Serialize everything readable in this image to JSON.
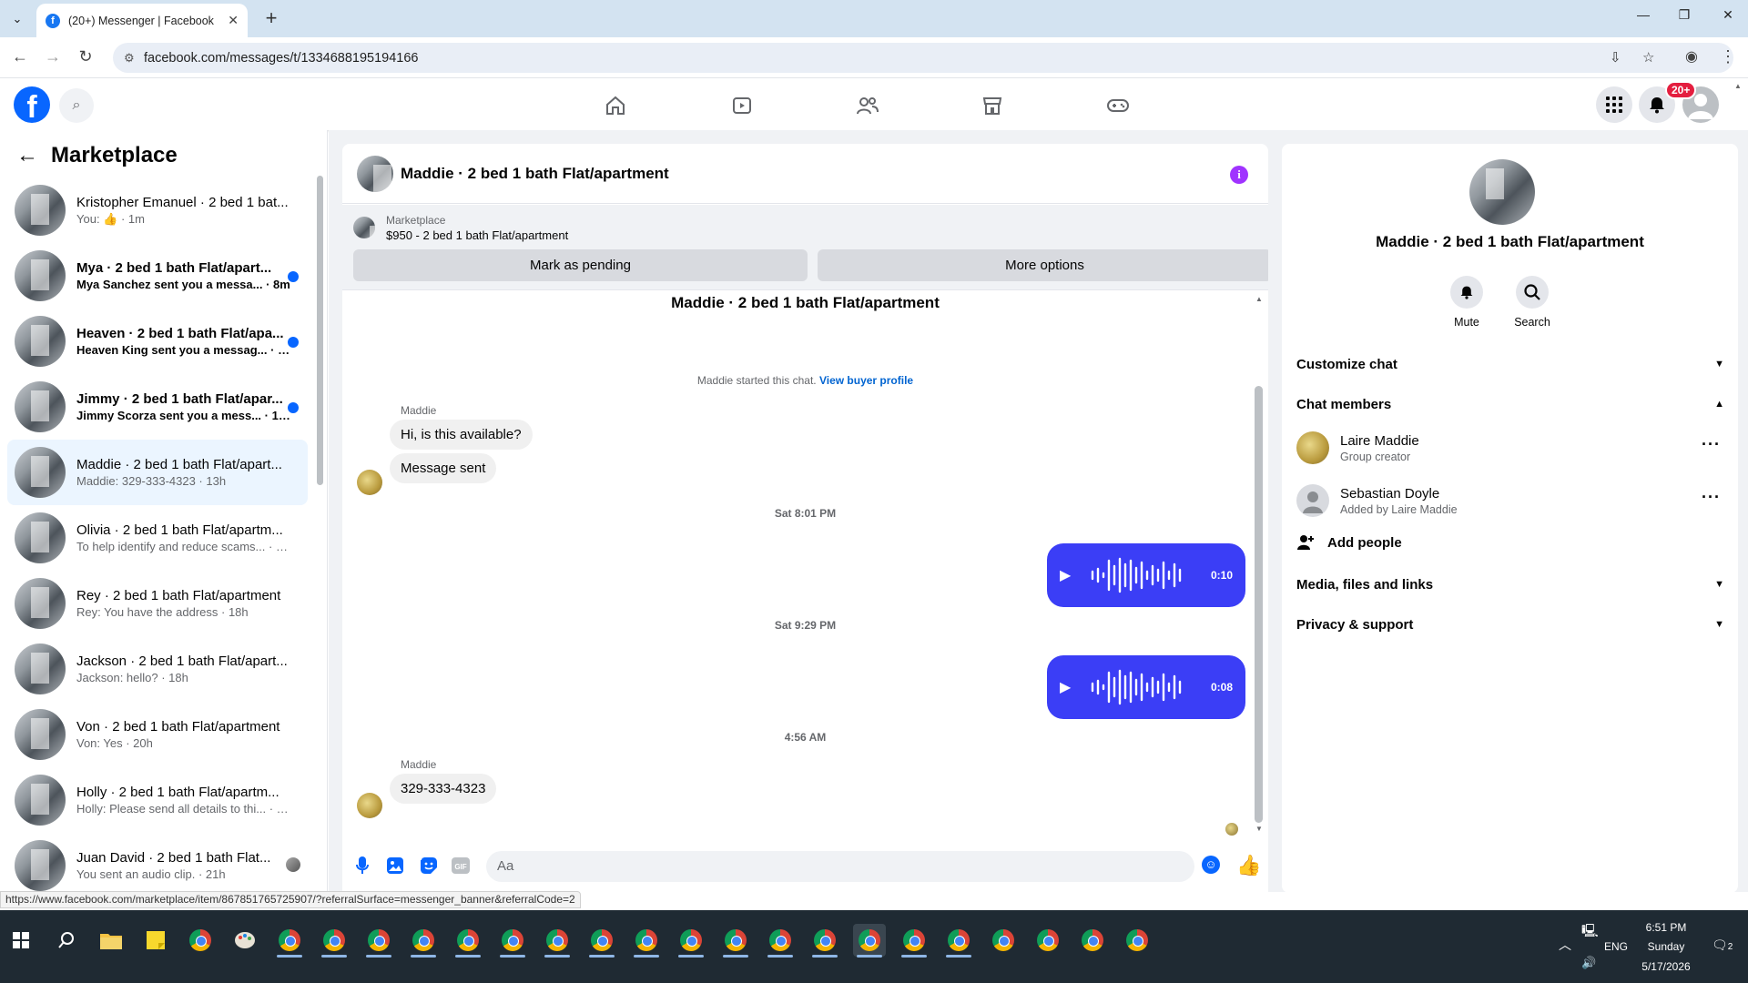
{
  "browser": {
    "tab_title": "(20+) Messenger | Facebook",
    "url": "facebook.com/messages/t/1334688195194166",
    "status_url": "https://www.facebook.com/marketplace/item/867851765725907/?referralSurface=messenger_banner&referralCode=2"
  },
  "fb": {
    "notif_badge": "20+"
  },
  "sidebar": {
    "title": "Marketplace",
    "conversations": [
      {
        "name": "Kristopher Emanuel · 2 bed 1 bat...",
        "preview_prefix": "You:",
        "preview": " · 1m",
        "unread": false
      },
      {
        "name": "Mya · 2 bed 1 bath Flat/apart...",
        "preview": "Mya Sanchez sent you a messa... · 8m",
        "unread": true
      },
      {
        "name": "Heaven · 2 bed 1 bath Flat/apa...",
        "preview": "Heaven King sent you a messag... · 8h",
        "unread": true
      },
      {
        "name": "Jimmy · 2 bed 1 bath Flat/apar...",
        "preview": "Jimmy Scorza sent you a mess... · 10h",
        "unread": true
      },
      {
        "name": "Maddie · 2 bed 1 bath Flat/apart...",
        "preview": "Maddie: 329-333-4323 · 13h",
        "unread": false
      },
      {
        "name": "Olivia · 2 bed 1 bath Flat/apartm...",
        "preview": "To help identify and reduce scams... · 16h",
        "unread": false
      },
      {
        "name": "Rey · 2 bed 1 bath Flat/apartment",
        "preview": "Rey: You have the address · 18h",
        "unread": false
      },
      {
        "name": "Jackson · 2 bed 1 bath Flat/apart...",
        "preview": "Jackson: hello? · 18h",
        "unread": false
      },
      {
        "name": "Von · 2 bed 1 bath Flat/apartment",
        "preview": "Von: Yes · 20h",
        "unread": false
      },
      {
        "name": "Holly · 2 bed 1 bath Flat/apartm...",
        "preview": "Holly: Please send all details to thi... · 21h",
        "unread": false
      },
      {
        "name": "Juan David · 2 bed 1 bath Flat...",
        "preview": "You sent an audio clip. · 21h",
        "unread": false
      }
    ]
  },
  "chat": {
    "title": "Maddie · 2 bed 1 bath Flat/apartment",
    "banner_label": "Marketplace",
    "banner_price": "$950 - 2 bed 1 bath Flat/apartment",
    "btn_pending": "Mark as pending",
    "btn_more": "More options",
    "thread_title": "Maddie · 2 bed 1 bath Flat/apartment",
    "started_text": "Maddie started this chat.",
    "started_link": "View buyer profile",
    "sender1": "Maddie",
    "msg1": "Hi, is this available?",
    "msg2": "Message sent",
    "ts1": "Sat 8:01 PM",
    "voice1": "0:10",
    "ts2": "Sat 9:29 PM",
    "voice2": "0:08",
    "ts3": "4:56 AM",
    "sender2": "Maddie",
    "msg3": "329-333-4323",
    "input_placeholder": "Aa"
  },
  "panel": {
    "title": "Maddie · 2 bed 1 bath Flat/apartment",
    "mute": "Mute",
    "search": "Search",
    "customize": "Customize chat",
    "members_header": "Chat members",
    "members": [
      {
        "name": "Laire Maddie",
        "sub": "Group creator"
      },
      {
        "name": "Sebastian Doyle",
        "sub": "Added by Laire Maddie"
      }
    ],
    "add_people": "Add people",
    "media": "Media, files and links",
    "privacy": "Privacy & support"
  },
  "taskbar": {
    "time": "6:51 PM",
    "day": "Sunday",
    "date": "5/17/2026",
    "lang": "ENG",
    "notif_count": "2"
  }
}
